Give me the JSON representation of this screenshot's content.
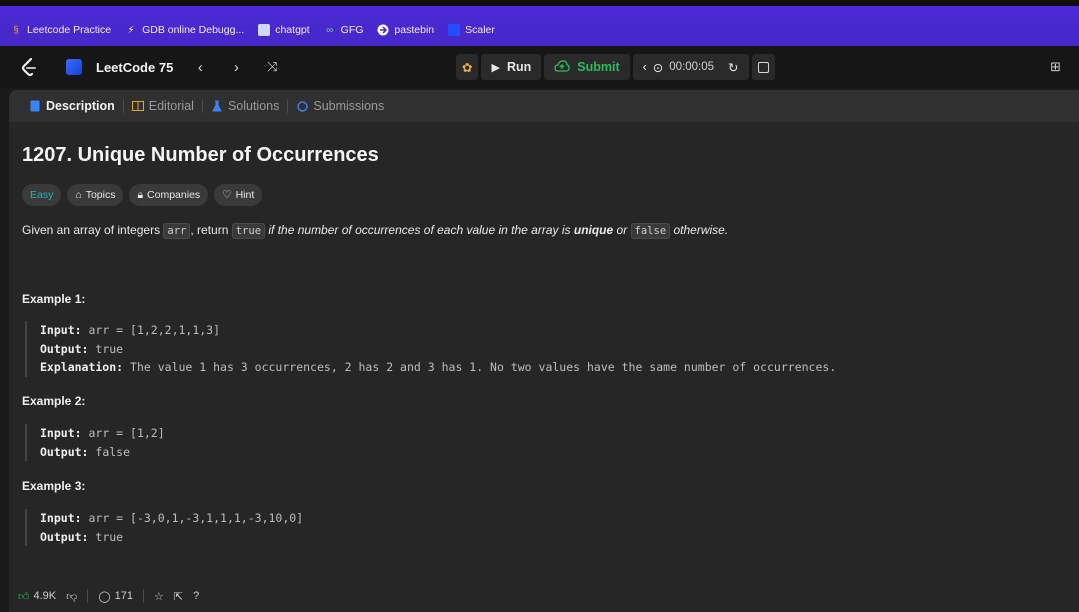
{
  "bookmarks": [
    {
      "label": "Leetcode Practice",
      "icon": "leetcode-icon",
      "color": "#ffa116"
    },
    {
      "label": "GDB online Debugg...",
      "icon": "bolt-icon",
      "color": "#ffffff"
    },
    {
      "label": "chatgpt",
      "icon": "chatgpt-icon",
      "color": "#cfd8ff"
    },
    {
      "label": "GFG",
      "icon": "gfg-icon",
      "color": "#2f8d46"
    },
    {
      "label": "pastebin",
      "icon": "pastebin-icon",
      "color": "#ffffff"
    },
    {
      "label": "Scaler",
      "icon": "scaler-icon",
      "color": "#1f4fff"
    }
  ],
  "nav": {
    "list_title": "LeetCode 75",
    "run_label": "Run",
    "submit_label": "Submit",
    "timer": "00:00:05"
  },
  "tabs": [
    {
      "label": "Description",
      "icon": "document-icon",
      "active": true
    },
    {
      "label": "Editorial",
      "icon": "book-icon",
      "active": false
    },
    {
      "label": "Solutions",
      "icon": "flask-icon",
      "active": false
    },
    {
      "label": "Submissions",
      "icon": "history-icon",
      "active": false
    }
  ],
  "problem": {
    "title": "1207. Unique Number of Occurrences",
    "chips": {
      "difficulty": "Easy",
      "topics": "Topics",
      "companies": "Companies",
      "hint": "Hint"
    },
    "desc": {
      "p1": "Given an array of integers ",
      "c1": "arr",
      "p2": ", return ",
      "c2": "true",
      "p3": " if the number of occurrences of each value in the array is ",
      "b1": "unique",
      "p4": " or ",
      "c3": "false",
      "p5": " otherwise."
    },
    "examples": [
      {
        "heading": "Example 1:",
        "input": "arr = [1,2,2,1,1,3]",
        "output": "true",
        "explanation": "The value 1 has 3 occurrences, 2 has 2 and 3 has 1. No two values have the same number of occurrences."
      },
      {
        "heading": "Example 2:",
        "input": "arr = [1,2]",
        "output": "false"
      },
      {
        "heading": "Example 3:",
        "input": "arr = [-3,0,1,-3,1,1,1,-3,10,0]",
        "output": "true"
      }
    ],
    "labels": {
      "input": "Input:",
      "output": "Output:",
      "explanation": "Explanation:"
    }
  },
  "footer": {
    "likes": "4.9K",
    "comments": "171"
  },
  "colors": {
    "accent_submit": "#2cbb5d",
    "easy": "#1cb8b8",
    "bookmark_bar": "#4527c8"
  }
}
